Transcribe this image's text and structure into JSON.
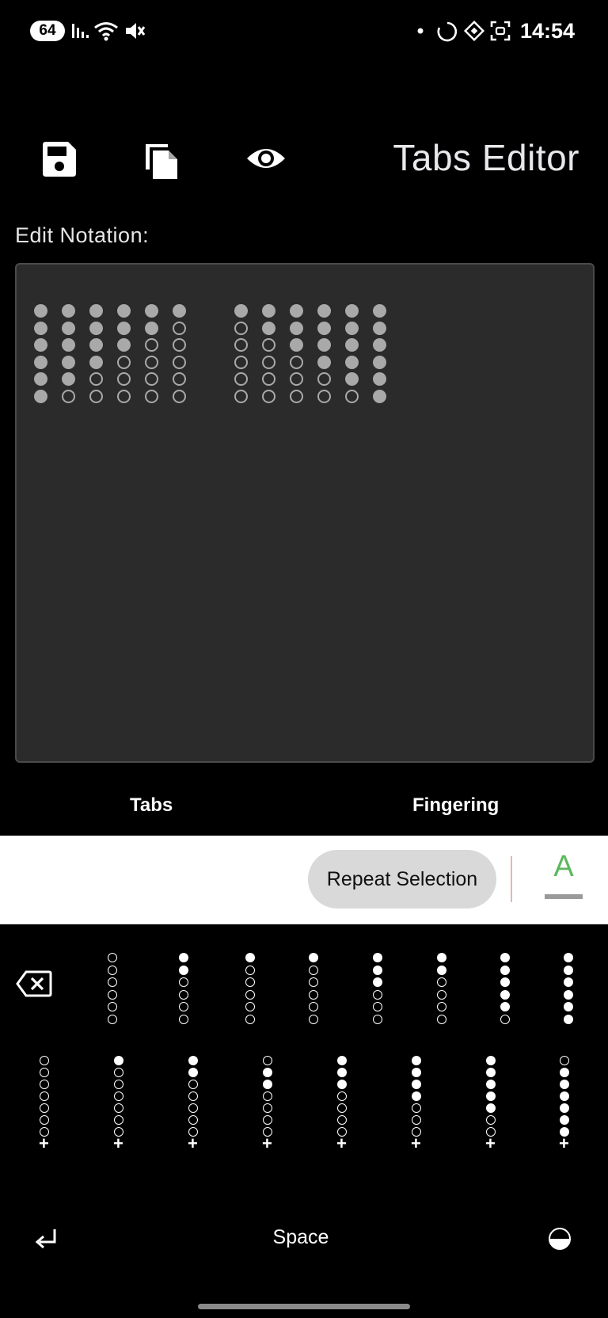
{
  "status_bar": {
    "badge": "64",
    "time": "14:54",
    "signal_icon": "signal-bars-icon",
    "wifi_icon": "wifi-icon",
    "mute_icon": "mute-icon",
    "dot_icon": "notification-dot-icon",
    "loader_icon": "sync-circle-icon",
    "diamond_icon": "diamond-icon",
    "screenshot_icon": "screenshot-icon"
  },
  "toolbar": {
    "title": "Tabs Editor",
    "icons": [
      "save-icon",
      "copy-icon",
      "view-icon"
    ]
  },
  "editor": {
    "label": "Edit Notation:",
    "columns": [
      [
        1,
        1,
        1,
        1,
        1,
        1
      ],
      [
        1,
        1,
        1,
        1,
        1,
        0
      ],
      [
        1,
        1,
        1,
        1,
        0,
        0
      ],
      [
        1,
        1,
        1,
        0,
        0,
        0
      ],
      [
        1,
        1,
        0,
        0,
        0,
        0
      ],
      [
        1,
        0,
        0,
        0,
        0,
        0
      ],
      [
        1,
        0,
        0,
        0,
        0,
        0
      ],
      [
        1,
        1,
        0,
        0,
        0,
        0
      ],
      [
        1,
        1,
        1,
        0,
        0,
        0
      ],
      [
        1,
        1,
        1,
        1,
        0,
        0
      ],
      [
        1,
        1,
        1,
        1,
        1,
        0
      ],
      [
        1,
        1,
        1,
        1,
        1,
        1
      ]
    ]
  },
  "tabs": [
    "Tabs",
    "Fingering"
  ],
  "suggestion_strip": {
    "repeat_label": "Repeat Selection",
    "font_color_letter": "A",
    "accent_color": "#5cb85c"
  },
  "keyboard": {
    "row1": [
      [
        0,
        0,
        0,
        0,
        0,
        0
      ],
      [
        1,
        1,
        0,
        0,
        0,
        0
      ],
      [
        1,
        0,
        0,
        0,
        0,
        0
      ],
      [
        1,
        0,
        0,
        0,
        0,
        0
      ],
      [
        1,
        1,
        1,
        0,
        0,
        0
      ],
      [
        1,
        1,
        0,
        0,
        0,
        0
      ],
      [
        1,
        1,
        1,
        1,
        1,
        0
      ],
      [
        1,
        1,
        1,
        1,
        1,
        1
      ]
    ],
    "row2": [
      [
        0,
        0,
        0,
        0,
        0,
        0,
        0
      ],
      [
        1,
        0,
        0,
        0,
        0,
        0,
        0
      ],
      [
        1,
        1,
        0,
        0,
        0,
        0,
        0
      ],
      [
        0,
        1,
        1,
        0,
        0,
        0,
        0
      ],
      [
        1,
        1,
        1,
        0,
        0,
        0,
        0
      ],
      [
        1,
        1,
        1,
        1,
        0,
        0,
        0
      ],
      [
        1,
        1,
        1,
        1,
        1,
        0,
        0
      ],
      [
        0,
        1,
        1,
        1,
        1,
        1,
        1
      ]
    ],
    "plus_label": "+",
    "space_label": "Space",
    "backspace_icon": "backspace-icon",
    "enter_icon": "enter-icon",
    "theme_icon": "theme-toggle-icon"
  }
}
